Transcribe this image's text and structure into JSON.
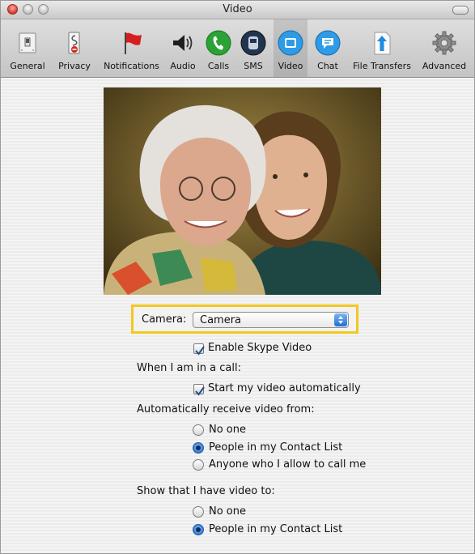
{
  "window": {
    "title": "Video"
  },
  "toolbar": {
    "items": [
      {
        "label": "General",
        "icon": "general-switch-icon"
      },
      {
        "label": "Privacy",
        "icon": "privacy-icon"
      },
      {
        "label": "Notifications",
        "icon": "flag-icon"
      },
      {
        "label": "Audio",
        "icon": "speaker-icon"
      },
      {
        "label": "Calls",
        "icon": "phone-icon"
      },
      {
        "label": "SMS",
        "icon": "sms-icon"
      },
      {
        "label": "Video",
        "icon": "video-icon",
        "selected": true
      },
      {
        "label": "Chat",
        "icon": "chat-icon"
      },
      {
        "label": "File Transfers",
        "icon": "upload-arrow-icon"
      },
      {
        "label": "Advanced",
        "icon": "gear-icon"
      }
    ]
  },
  "camera": {
    "label": "Camera:",
    "selected": "Camera"
  },
  "enable_video": {
    "label": "Enable Skype Video",
    "checked": true
  },
  "in_call": {
    "heading": "When I am in a call:",
    "start_video": {
      "label": "Start my video automatically",
      "checked": true
    }
  },
  "receive_from": {
    "heading": "Automatically receive video from:",
    "options": [
      {
        "label": "No one",
        "selected": false
      },
      {
        "label": "People in my Contact List",
        "selected": true
      },
      {
        "label": "Anyone who I allow to call me",
        "selected": false
      }
    ]
  },
  "show_video": {
    "heading": "Show that I have video to:",
    "options": [
      {
        "label": "No one",
        "selected": false
      },
      {
        "label": "People in my Contact List",
        "selected": true
      }
    ]
  },
  "colors": {
    "highlight": "#f3c81f",
    "accent_blue": "#2f78d6"
  }
}
